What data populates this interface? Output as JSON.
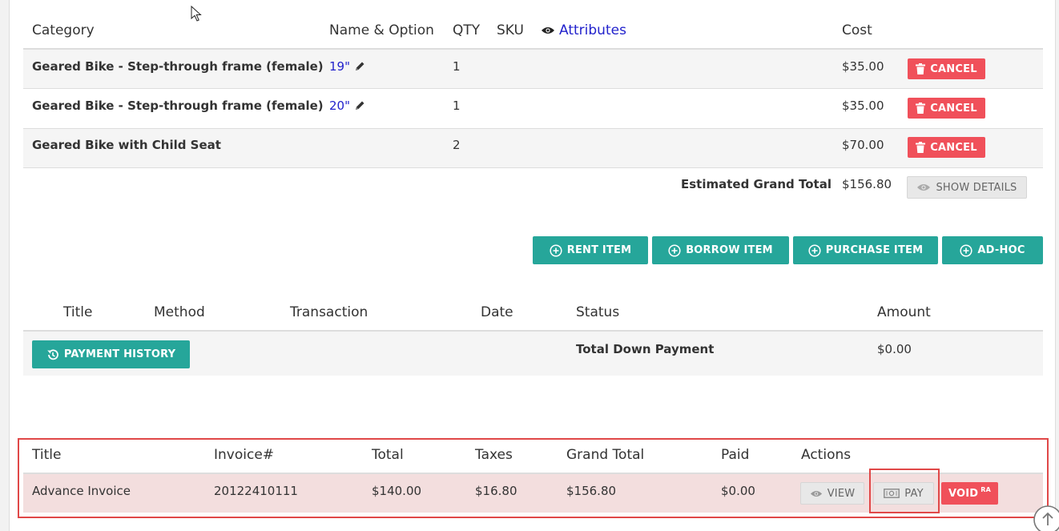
{
  "items": {
    "headers": {
      "category": "Category",
      "name_option": "Name & Option",
      "qty": "QTY",
      "sku": "SKU",
      "attributes": "Attributes",
      "cost": "Cost"
    },
    "rows": [
      {
        "category": "Geared Bike - Step-through frame (female)",
        "option": "19\"",
        "qty": "1",
        "cost": "$35.00",
        "action": "CANCEL"
      },
      {
        "category": "Geared Bike - Step-through frame (female)",
        "option": "20\"",
        "qty": "1",
        "cost": "$35.00",
        "action": "CANCEL"
      },
      {
        "category": "Geared Bike with Child Seat",
        "option": "",
        "qty": "2",
        "cost": "$70.00",
        "action": "CANCEL"
      }
    ],
    "total_label": "Estimated Grand Total",
    "total_value": "$156.80",
    "show_details": "SHOW DETAILS"
  },
  "actions": {
    "rent": "RENT ITEM",
    "borrow": "BORROW ITEM",
    "purchase": "PURCHASE ITEM",
    "adhoc": "AD-HOC"
  },
  "payments": {
    "headers": {
      "title": "Title",
      "method": "Method",
      "transaction": "Transaction",
      "date": "Date",
      "status": "Status",
      "amount": "Amount"
    },
    "history_button": "PAYMENT HISTORY",
    "down_payment_label": "Total Down Payment",
    "down_payment_value": "$0.00"
  },
  "invoices": {
    "headers": {
      "title": "Title",
      "invoice": "Invoice#",
      "total": "Total",
      "taxes": "Taxes",
      "grand_total": "Grand Total",
      "paid": "Paid",
      "actions": "Actions"
    },
    "row": {
      "title": "Advance Invoice",
      "invoice": "20122410111",
      "total": "$140.00",
      "taxes": "$16.80",
      "grand_total": "$156.80",
      "paid": "$0.00"
    },
    "view": "VIEW",
    "pay": "PAY",
    "void": "VOID",
    "void_sup": "RA"
  },
  "colors": {
    "teal": "#26a69a",
    "red": "#f0505a",
    "highlight": "#e04848",
    "link": "#2222cc"
  }
}
